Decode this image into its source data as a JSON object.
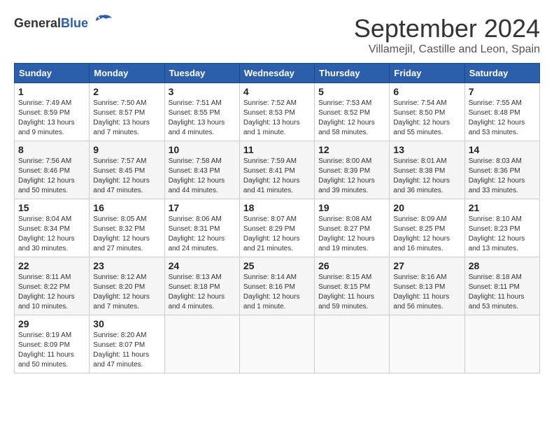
{
  "logo": {
    "general": "General",
    "blue": "Blue"
  },
  "header": {
    "month_year": "September 2024",
    "location": "Villamejil, Castille and Leon, Spain"
  },
  "weekdays": [
    "Sunday",
    "Monday",
    "Tuesday",
    "Wednesday",
    "Thursday",
    "Friday",
    "Saturday"
  ],
  "weeks": [
    [
      {
        "day": "1",
        "sunrise": "7:49 AM",
        "sunset": "8:59 PM",
        "daylight": "13 hours and 9 minutes."
      },
      {
        "day": "2",
        "sunrise": "7:50 AM",
        "sunset": "8:57 PM",
        "daylight": "13 hours and 7 minutes."
      },
      {
        "day": "3",
        "sunrise": "7:51 AM",
        "sunset": "8:55 PM",
        "daylight": "13 hours and 4 minutes."
      },
      {
        "day": "4",
        "sunrise": "7:52 AM",
        "sunset": "8:53 PM",
        "daylight": "13 hours and 1 minute."
      },
      {
        "day": "5",
        "sunrise": "7:53 AM",
        "sunset": "8:52 PM",
        "daylight": "12 hours and 58 minutes."
      },
      {
        "day": "6",
        "sunrise": "7:54 AM",
        "sunset": "8:50 PM",
        "daylight": "12 hours and 55 minutes."
      },
      {
        "day": "7",
        "sunrise": "7:55 AM",
        "sunset": "8:48 PM",
        "daylight": "12 hours and 53 minutes."
      }
    ],
    [
      {
        "day": "8",
        "sunrise": "7:56 AM",
        "sunset": "8:46 PM",
        "daylight": "12 hours and 50 minutes."
      },
      {
        "day": "9",
        "sunrise": "7:57 AM",
        "sunset": "8:45 PM",
        "daylight": "12 hours and 47 minutes."
      },
      {
        "day": "10",
        "sunrise": "7:58 AM",
        "sunset": "8:43 PM",
        "daylight": "12 hours and 44 minutes."
      },
      {
        "day": "11",
        "sunrise": "7:59 AM",
        "sunset": "8:41 PM",
        "daylight": "12 hours and 41 minutes."
      },
      {
        "day": "12",
        "sunrise": "8:00 AM",
        "sunset": "8:39 PM",
        "daylight": "12 hours and 39 minutes."
      },
      {
        "day": "13",
        "sunrise": "8:01 AM",
        "sunset": "8:38 PM",
        "daylight": "12 hours and 36 minutes."
      },
      {
        "day": "14",
        "sunrise": "8:03 AM",
        "sunset": "8:36 PM",
        "daylight": "12 hours and 33 minutes."
      }
    ],
    [
      {
        "day": "15",
        "sunrise": "8:04 AM",
        "sunset": "8:34 PM",
        "daylight": "12 hours and 30 minutes."
      },
      {
        "day": "16",
        "sunrise": "8:05 AM",
        "sunset": "8:32 PM",
        "daylight": "12 hours and 27 minutes."
      },
      {
        "day": "17",
        "sunrise": "8:06 AM",
        "sunset": "8:31 PM",
        "daylight": "12 hours and 24 minutes."
      },
      {
        "day": "18",
        "sunrise": "8:07 AM",
        "sunset": "8:29 PM",
        "daylight": "12 hours and 21 minutes."
      },
      {
        "day": "19",
        "sunrise": "8:08 AM",
        "sunset": "8:27 PM",
        "daylight": "12 hours and 19 minutes."
      },
      {
        "day": "20",
        "sunrise": "8:09 AM",
        "sunset": "8:25 PM",
        "daylight": "12 hours and 16 minutes."
      },
      {
        "day": "21",
        "sunrise": "8:10 AM",
        "sunset": "8:23 PM",
        "daylight": "12 hours and 13 minutes."
      }
    ],
    [
      {
        "day": "22",
        "sunrise": "8:11 AM",
        "sunset": "8:22 PM",
        "daylight": "12 hours and 10 minutes."
      },
      {
        "day": "23",
        "sunrise": "8:12 AM",
        "sunset": "8:20 PM",
        "daylight": "12 hours and 7 minutes."
      },
      {
        "day": "24",
        "sunrise": "8:13 AM",
        "sunset": "8:18 PM",
        "daylight": "12 hours and 4 minutes."
      },
      {
        "day": "25",
        "sunrise": "8:14 AM",
        "sunset": "8:16 PM",
        "daylight": "12 hours and 1 minute."
      },
      {
        "day": "26",
        "sunrise": "8:15 AM",
        "sunset": "8:15 PM",
        "daylight": "11 hours and 59 minutes."
      },
      {
        "day": "27",
        "sunrise": "8:16 AM",
        "sunset": "8:13 PM",
        "daylight": "11 hours and 56 minutes."
      },
      {
        "day": "28",
        "sunrise": "8:18 AM",
        "sunset": "8:11 PM",
        "daylight": "11 hours and 53 minutes."
      }
    ],
    [
      {
        "day": "29",
        "sunrise": "8:19 AM",
        "sunset": "8:09 PM",
        "daylight": "11 hours and 50 minutes."
      },
      {
        "day": "30",
        "sunrise": "8:20 AM",
        "sunset": "8:07 PM",
        "daylight": "11 hours and 47 minutes."
      },
      null,
      null,
      null,
      null,
      null
    ]
  ]
}
